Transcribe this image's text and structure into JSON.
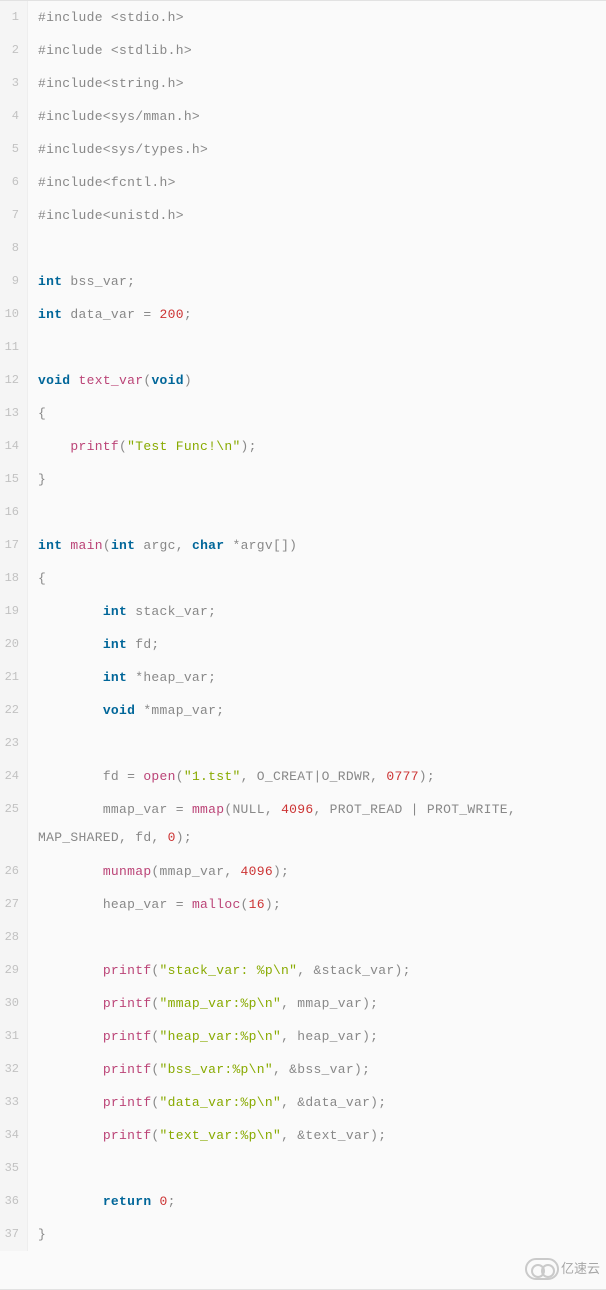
{
  "lines": [
    {
      "n": "1",
      "tokens": [
        {
          "c": "pp",
          "t": "#include <stdio.h>"
        }
      ]
    },
    {
      "n": "2",
      "tokens": [
        {
          "c": "pp",
          "t": "#include <stdlib.h>"
        }
      ]
    },
    {
      "n": "3",
      "tokens": [
        {
          "c": "pp",
          "t": "#include<string.h>"
        }
      ]
    },
    {
      "n": "4",
      "tokens": [
        {
          "c": "pp",
          "t": "#include<sys/mman.h>"
        }
      ]
    },
    {
      "n": "5",
      "tokens": [
        {
          "c": "pp",
          "t": "#include<sys/types.h>"
        }
      ]
    },
    {
      "n": "6",
      "tokens": [
        {
          "c": "pp",
          "t": "#include<fcntl.h>"
        }
      ]
    },
    {
      "n": "7",
      "tokens": [
        {
          "c": "pp",
          "t": "#include<unistd.h>"
        }
      ]
    },
    {
      "n": "8",
      "tokens": []
    },
    {
      "n": "9",
      "tokens": [
        {
          "c": "kw",
          "t": "int"
        },
        {
          "c": "id",
          "t": " bss_var;"
        }
      ]
    },
    {
      "n": "10",
      "tokens": [
        {
          "c": "kw",
          "t": "int"
        },
        {
          "c": "id",
          "t": " data_var = "
        },
        {
          "c": "num",
          "t": "200"
        },
        {
          "c": "id",
          "t": ";"
        }
      ]
    },
    {
      "n": "11",
      "tokens": []
    },
    {
      "n": "12",
      "tokens": [
        {
          "c": "kw",
          "t": "void"
        },
        {
          "c": "id",
          "t": " "
        },
        {
          "c": "fn",
          "t": "text_var"
        },
        {
          "c": "id",
          "t": "("
        },
        {
          "c": "kw",
          "t": "void"
        },
        {
          "c": "id",
          "t": ")"
        }
      ]
    },
    {
      "n": "13",
      "tokens": [
        {
          "c": "id",
          "t": "{"
        }
      ]
    },
    {
      "n": "14",
      "tokens": [
        {
          "c": "id",
          "t": "    "
        },
        {
          "c": "fn",
          "t": "printf"
        },
        {
          "c": "id",
          "t": "("
        },
        {
          "c": "str",
          "t": "\"Test Func!\\n\""
        },
        {
          "c": "id",
          "t": ");"
        }
      ]
    },
    {
      "n": "15",
      "tokens": [
        {
          "c": "id",
          "t": "}"
        }
      ]
    },
    {
      "n": "16",
      "tokens": []
    },
    {
      "n": "17",
      "tokens": [
        {
          "c": "kw",
          "t": "int"
        },
        {
          "c": "id",
          "t": " "
        },
        {
          "c": "fn",
          "t": "main"
        },
        {
          "c": "id",
          "t": "("
        },
        {
          "c": "kw",
          "t": "int"
        },
        {
          "c": "id",
          "t": " argc, "
        },
        {
          "c": "kw",
          "t": "char"
        },
        {
          "c": "id",
          "t": " *argv[])"
        }
      ]
    },
    {
      "n": "18",
      "tokens": [
        {
          "c": "id",
          "t": "{"
        }
      ]
    },
    {
      "n": "19",
      "tokens": [
        {
          "c": "id",
          "t": "        "
        },
        {
          "c": "kw",
          "t": "int"
        },
        {
          "c": "id",
          "t": " stack_var;"
        }
      ]
    },
    {
      "n": "20",
      "tokens": [
        {
          "c": "id",
          "t": "        "
        },
        {
          "c": "kw",
          "t": "int"
        },
        {
          "c": "id",
          "t": " fd;"
        }
      ]
    },
    {
      "n": "21",
      "tokens": [
        {
          "c": "id",
          "t": "        "
        },
        {
          "c": "kw",
          "t": "int"
        },
        {
          "c": "id",
          "t": " *heap_var;"
        }
      ]
    },
    {
      "n": "22",
      "tokens": [
        {
          "c": "id",
          "t": "        "
        },
        {
          "c": "kw",
          "t": "void"
        },
        {
          "c": "id",
          "t": " *mmap_var;"
        }
      ]
    },
    {
      "n": "23",
      "tokens": []
    },
    {
      "n": "24",
      "tokens": [
        {
          "c": "id",
          "t": "        fd = "
        },
        {
          "c": "fn",
          "t": "open"
        },
        {
          "c": "id",
          "t": "("
        },
        {
          "c": "str",
          "t": "\"1.tst\""
        },
        {
          "c": "id",
          "t": ", O_CREAT|O_RDWR, "
        },
        {
          "c": "num",
          "t": "0777"
        },
        {
          "c": "id",
          "t": ");"
        }
      ]
    },
    {
      "n": "25",
      "wrap": true,
      "tokens": [
        {
          "c": "id",
          "t": "        mmap_var = "
        },
        {
          "c": "fn",
          "t": "mmap"
        },
        {
          "c": "id",
          "t": "(NULL, "
        },
        {
          "c": "num",
          "t": "4096"
        },
        {
          "c": "id",
          "t": ", PROT_READ | PROT_WRITE, MAP_SHARED, fd, "
        },
        {
          "c": "num",
          "t": "0"
        },
        {
          "c": "id",
          "t": ");"
        }
      ]
    },
    {
      "n": "26",
      "tokens": [
        {
          "c": "id",
          "t": "        "
        },
        {
          "c": "fn",
          "t": "munmap"
        },
        {
          "c": "id",
          "t": "(mmap_var, "
        },
        {
          "c": "num",
          "t": "4096"
        },
        {
          "c": "id",
          "t": ");"
        }
      ]
    },
    {
      "n": "27",
      "tokens": [
        {
          "c": "id",
          "t": "        heap_var = "
        },
        {
          "c": "fn",
          "t": "malloc"
        },
        {
          "c": "id",
          "t": "("
        },
        {
          "c": "num",
          "t": "16"
        },
        {
          "c": "id",
          "t": ");"
        }
      ]
    },
    {
      "n": "28",
      "tokens": []
    },
    {
      "n": "29",
      "tokens": [
        {
          "c": "id",
          "t": "        "
        },
        {
          "c": "fn",
          "t": "printf"
        },
        {
          "c": "id",
          "t": "("
        },
        {
          "c": "str",
          "t": "\"stack_var: %p\\n\""
        },
        {
          "c": "id",
          "t": ", &stack_var);"
        }
      ]
    },
    {
      "n": "30",
      "tokens": [
        {
          "c": "id",
          "t": "        "
        },
        {
          "c": "fn",
          "t": "printf"
        },
        {
          "c": "id",
          "t": "("
        },
        {
          "c": "str",
          "t": "\"mmap_var:%p\\n\""
        },
        {
          "c": "id",
          "t": ", mmap_var);"
        }
      ]
    },
    {
      "n": "31",
      "tokens": [
        {
          "c": "id",
          "t": "        "
        },
        {
          "c": "fn",
          "t": "printf"
        },
        {
          "c": "id",
          "t": "("
        },
        {
          "c": "str",
          "t": "\"heap_var:%p\\n\""
        },
        {
          "c": "id",
          "t": ", heap_var);"
        }
      ]
    },
    {
      "n": "32",
      "tokens": [
        {
          "c": "id",
          "t": "        "
        },
        {
          "c": "fn",
          "t": "printf"
        },
        {
          "c": "id",
          "t": "("
        },
        {
          "c": "str",
          "t": "\"bss_var:%p\\n\""
        },
        {
          "c": "id",
          "t": ", &bss_var);"
        }
      ]
    },
    {
      "n": "33",
      "tokens": [
        {
          "c": "id",
          "t": "        "
        },
        {
          "c": "fn",
          "t": "printf"
        },
        {
          "c": "id",
          "t": "("
        },
        {
          "c": "str",
          "t": "\"data_var:%p\\n\""
        },
        {
          "c": "id",
          "t": ", &data_var);"
        }
      ]
    },
    {
      "n": "34",
      "tokens": [
        {
          "c": "id",
          "t": "        "
        },
        {
          "c": "fn",
          "t": "printf"
        },
        {
          "c": "id",
          "t": "("
        },
        {
          "c": "str",
          "t": "\"text_var:%p\\n\""
        },
        {
          "c": "id",
          "t": ", &text_var);"
        }
      ]
    },
    {
      "n": "35",
      "tokens": []
    },
    {
      "n": "36",
      "tokens": [
        {
          "c": "id",
          "t": "        "
        },
        {
          "c": "kw",
          "t": "return"
        },
        {
          "c": "id",
          "t": " "
        },
        {
          "c": "num",
          "t": "0"
        },
        {
          "c": "id",
          "t": ";"
        }
      ]
    },
    {
      "n": "37",
      "tokens": [
        {
          "c": "id",
          "t": "}"
        }
      ]
    }
  ],
  "watermark": "亿速云"
}
